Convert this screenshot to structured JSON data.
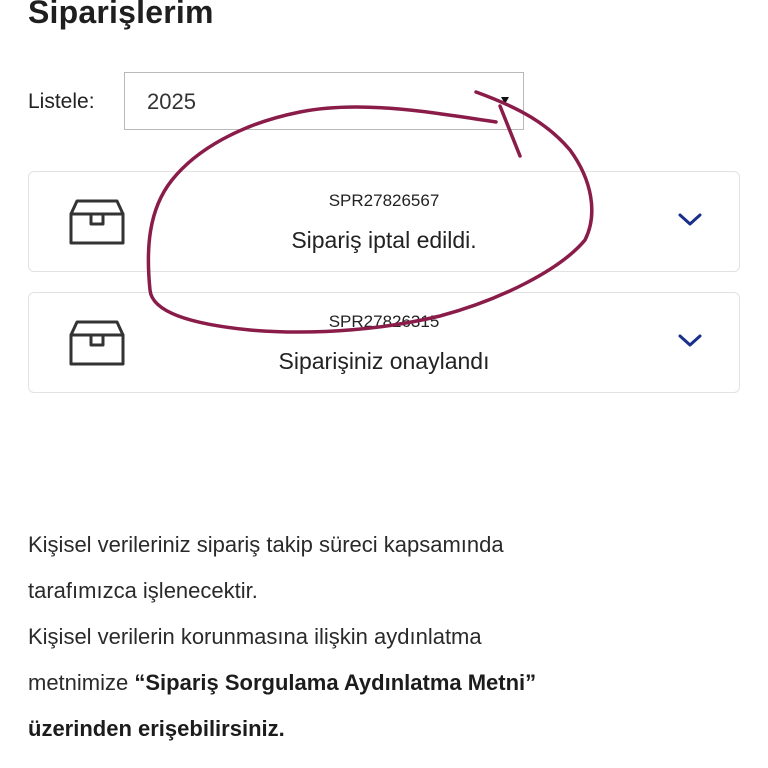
{
  "header": {
    "title": "Siparişlerim"
  },
  "filter": {
    "label": "Listele:",
    "selected_year": "2025"
  },
  "orders": [
    {
      "order_no": "SPR27826567",
      "status": "Sipariş iptal edildi."
    },
    {
      "order_no": "SPR27826315",
      "status": "Siparişiniz onaylandı"
    }
  ],
  "privacy": {
    "line1": "Kişisel verileriniz sipariş takip süreci kapsamında",
    "line2": "tarafımızca işlenecektir.",
    "line3": "Kişisel verilerin korunmasına ilişkin aydınlatma",
    "line4_prefix": "metnimize",
    "link_text": "“Sipariş Sorgulama Aydınlatma Metni”",
    "line5": "üzerinden erişebilirsiniz."
  },
  "colors": {
    "accent": "#1a2f8a",
    "annotation": "#8a1c4a",
    "text": "#222222"
  },
  "icons": {
    "order": "package-box-icon",
    "expand": "chevron-down-icon",
    "select": "caret-down-icon"
  }
}
